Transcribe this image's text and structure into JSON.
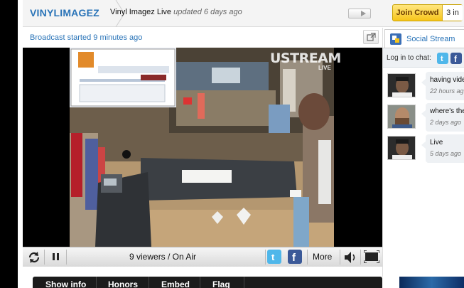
{
  "header": {
    "channel_name": "VINYLIMAGEZ",
    "show_title": "Vinyl Imagez Live",
    "updated": "updated 6 days ago",
    "join_label": "Join Crowd",
    "crowd_count": "3 in"
  },
  "subheader": {
    "broadcast_status": "Broadcast started 9 minutes ago"
  },
  "video": {
    "watermark": "USTREAM",
    "watermark_sub": "LIVE"
  },
  "controls": {
    "viewers": "9 viewers / On Air",
    "more_label": "More"
  },
  "tabs": [
    {
      "label": "Show info"
    },
    {
      "label": "Honors"
    },
    {
      "label": "Embed"
    },
    {
      "label": "Flag"
    }
  ],
  "sidebar": {
    "social_tab_label": "Social Stream",
    "login_prompt": "Log in to chat:",
    "messages": [
      {
        "text": "having vide",
        "time": "22 hours ag"
      },
      {
        "text": "where's the",
        "time": "2 days ago"
      },
      {
        "text": "Live",
        "time": "5 days ago"
      }
    ]
  },
  "colors": {
    "accent_blue": "#2a74b8",
    "join_yellow": "#f7c51a",
    "twitter": "#4fb7ea",
    "facebook": "#3b5998"
  }
}
